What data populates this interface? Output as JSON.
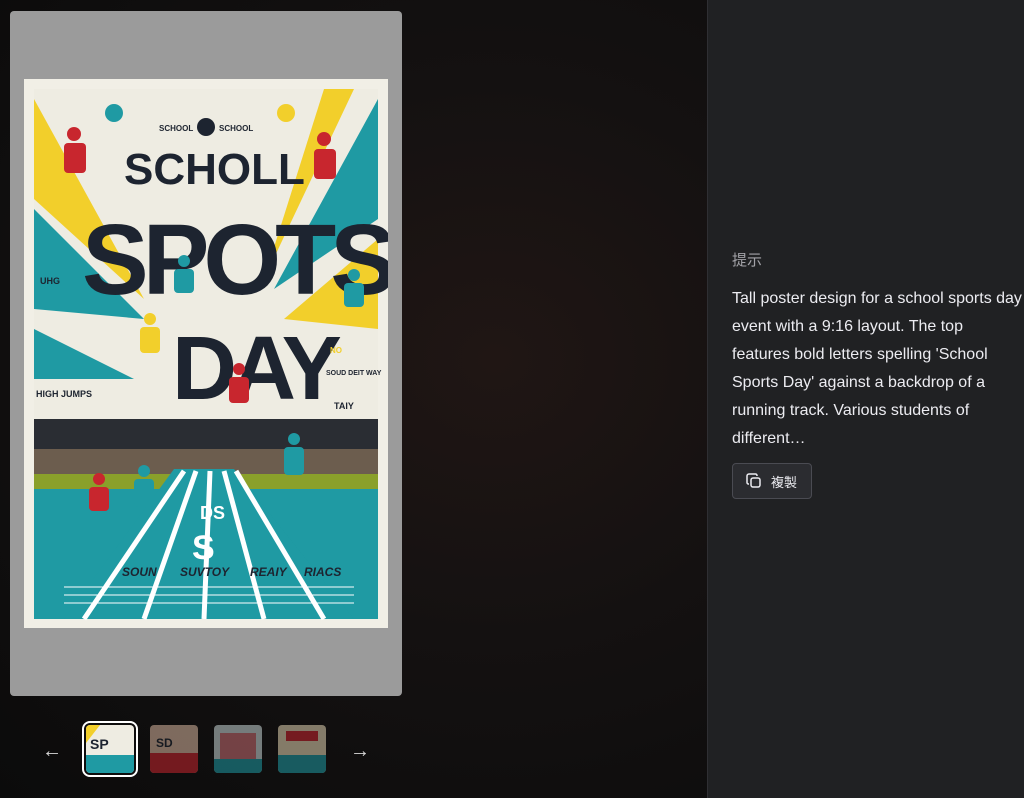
{
  "viewer": {
    "poster": {
      "header_small": "SCHOOL",
      "header_small_right": "SCHOOL",
      "title_line1": "SCHOLL",
      "title_line2": "SPOTS",
      "title_line3": "DAY",
      "side_left": "HIGH JUMPS",
      "side_right_top": "SOUD DEIT WAY",
      "side_right": "TAIY",
      "side_left_top": "UHG",
      "side_mid_right": "NO",
      "track_big": "S",
      "track_small": "DS",
      "lane_labels": [
        "SOUN",
        "SUVTOY",
        "REAIY",
        "RIACS"
      ]
    },
    "nav_prev_icon": "arrow-left-icon",
    "nav_next_icon": "arrow-right-icon"
  },
  "side_panel": {
    "heading": "提示",
    "prompt": "Tall poster design for a school sports day event with a 9:16 layout. The top features bold letters spelling 'School Sports Day' against a backdrop of a running track. Various students of different…",
    "copy_label": "複製",
    "copy_icon": "copy-icon"
  },
  "colors": {
    "teal": "#1f9aa3",
    "yellow": "#f2cf2b",
    "navy": "#1d2430",
    "red": "#c8262e"
  }
}
